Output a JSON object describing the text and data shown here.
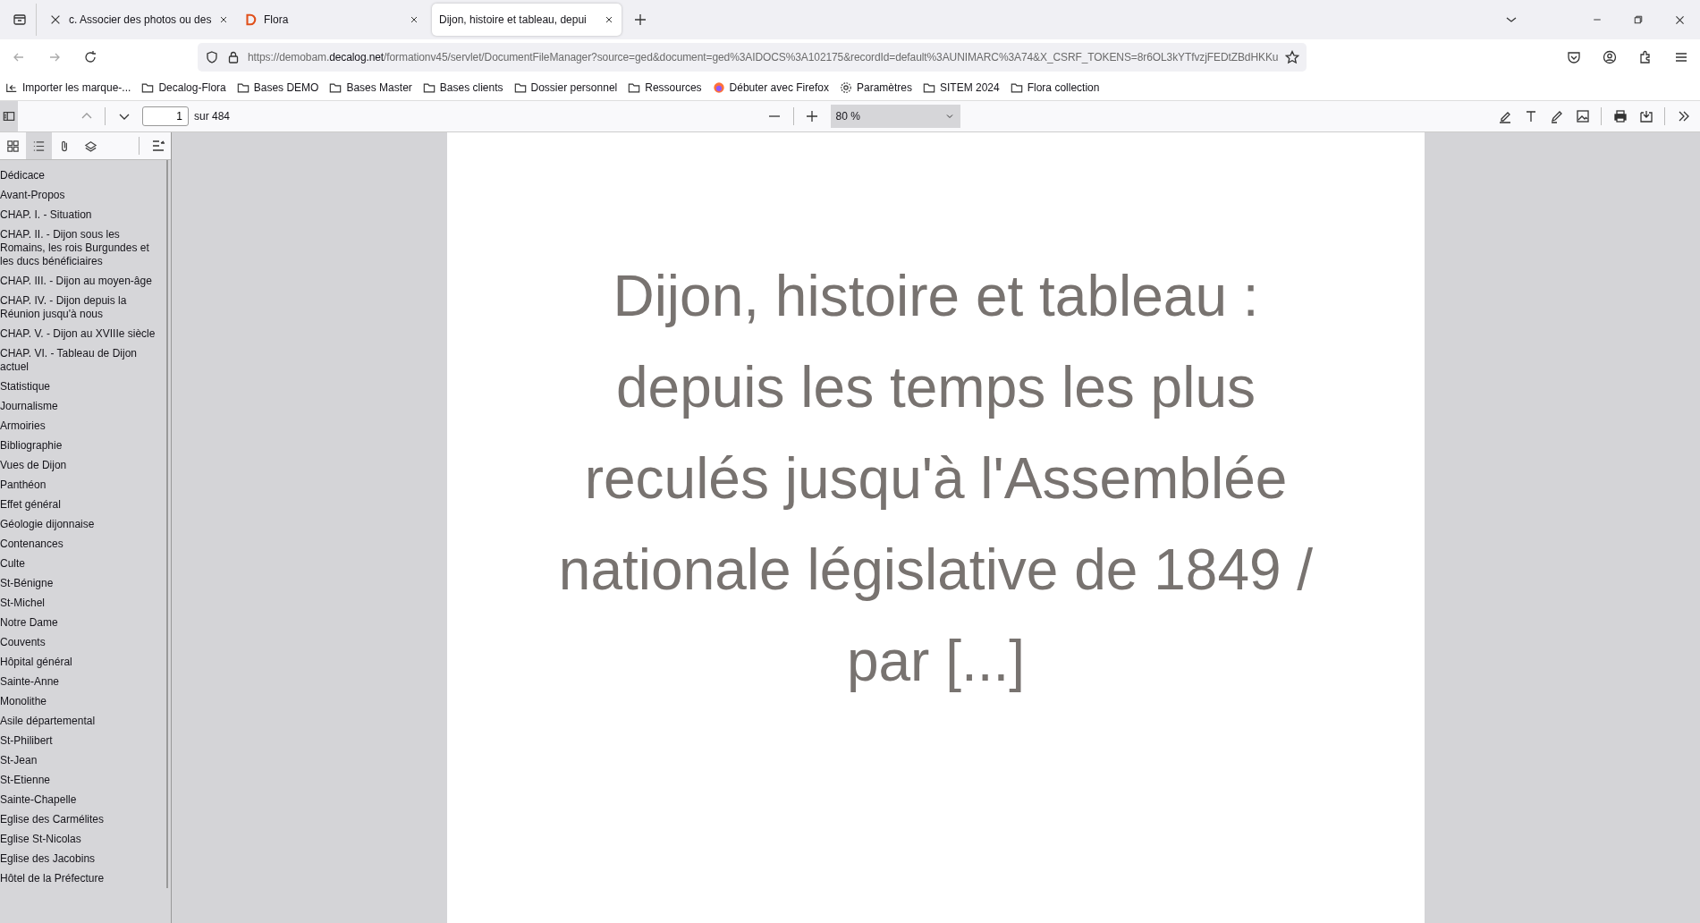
{
  "tabs": [
    {
      "title": "c. Associer des photos ou des",
      "selected": false
    },
    {
      "title": "Flora",
      "selected": false
    },
    {
      "title": "Dijon, histoire et tableau, depui",
      "selected": true
    }
  ],
  "address": {
    "before": "https://demobam.",
    "domain": "decalog.net",
    "after": "/formationv45/servlet/DocumentFileManager?source=ged&document=ged%3AIDOCS%3A102175&recordId=default%3AUNIMARC%3A74&X_CSRF_TOKENS=8r6OL3kYTfvzjFEDtZBdHKKu"
  },
  "bookmarks": [
    {
      "label": "Importer les marque-...",
      "kind": "import"
    },
    {
      "label": "Decalog-Flora",
      "kind": "folder"
    },
    {
      "label": "Bases DEMO",
      "kind": "folder"
    },
    {
      "label": "Bases Master",
      "kind": "folder"
    },
    {
      "label": "Bases clients",
      "kind": "folder"
    },
    {
      "label": "Dossier personnel",
      "kind": "folder"
    },
    {
      "label": "Ressources",
      "kind": "folder"
    },
    {
      "label": "Débuter avec Firefox",
      "kind": "firefox"
    },
    {
      "label": "Paramètres",
      "kind": "gear"
    },
    {
      "label": "SITEM 2024",
      "kind": "folder"
    },
    {
      "label": "Flora collection",
      "kind": "folder"
    }
  ],
  "viewer": {
    "page": "1",
    "page_count": "sur 484",
    "zoom": "80 %"
  },
  "sidebar": {
    "views": [
      {
        "kind": "thumbnails",
        "selected": false
      },
      {
        "kind": "outline",
        "selected": true
      },
      {
        "kind": "attachments",
        "selected": false
      },
      {
        "kind": "layers",
        "selected": false
      }
    ],
    "items": [
      "Dédicace",
      "Avant-Propos",
      "CHAP. I. - Situation",
      "CHAP. II. - Dijon sous les Romains, les rois Burgundes et les ducs bénéficiaires",
      "CHAP. III. - Dijon au moyen-âge",
      "CHAP. IV. - Dijon depuis la Réunion jusqu'à nous",
      "CHAP. V. - Dijon au XVIIIe siècle",
      "CHAP. VI. - Tableau de Dijon actuel",
      "Statistique",
      "Journalisme",
      "Armoiries",
      "Bibliographie",
      "Vues de Dijon",
      "Panthéon",
      "Effet général",
      "Géologie dijonnaise",
      "Contenances",
      "Culte",
      "St-Bénigne",
      "St-Michel",
      "Notre Dame",
      "Couvents",
      "Hôpital général",
      "Sainte-Anne",
      "Monolithe",
      "Asile départemental",
      "St-Philibert",
      "St-Jean",
      "St-Etienne",
      "Sainte-Chapelle",
      "Eglise des Carmélites",
      "Eglise St-Nicolas",
      "Eglise des Jacobins",
      "Hôtel de la Préfecture"
    ]
  },
  "document": {
    "title": "Dijon, histoire et tableau : depuis les temps les plus reculés jusqu'à l'Assemblée nationale législative de 1849 / par [...]"
  }
}
